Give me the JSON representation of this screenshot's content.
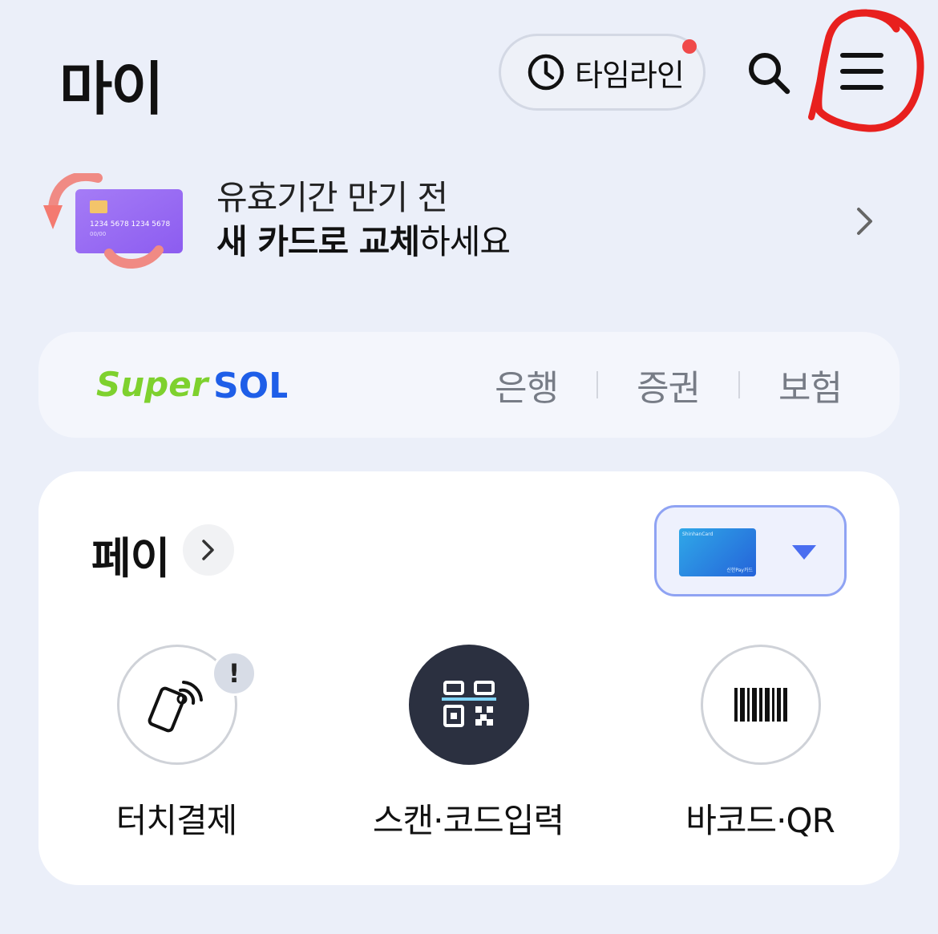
{
  "header": {
    "title": "마이",
    "timeline_label": "타임라인",
    "timeline_has_notification": true
  },
  "banner": {
    "line1": "유효기간 만기 전",
    "line2_bold": "새 카드로 교체",
    "line2_rest": "하세요",
    "card_number": "1234 5678 1234 5678",
    "card_expiry": "00/00"
  },
  "supersol": {
    "logo_text_super": "Super",
    "logo_text_sol": "SOL",
    "links": [
      "은행",
      "증권",
      "보험"
    ]
  },
  "pay": {
    "title": "페이",
    "selected_card": {
      "brand": "ShinhanCard",
      "pay_label": "신한Pay카드"
    },
    "actions": [
      {
        "label": "터치결제",
        "icon": "phone-nfc-icon",
        "alert": "!"
      },
      {
        "label": "스캔·코드입력",
        "icon": "qr-scan-icon"
      },
      {
        "label": "바코드·QR",
        "icon": "barcode-icon"
      }
    ]
  },
  "colors": {
    "background": "#ebeff9",
    "notification_dot": "#f04a4a",
    "annotation": "#e8201e",
    "logo_green": "#7ed12e",
    "logo_blue": "#1e5ee8",
    "card_select_border": "#8fa3f3",
    "caret": "#4a6ef0"
  }
}
